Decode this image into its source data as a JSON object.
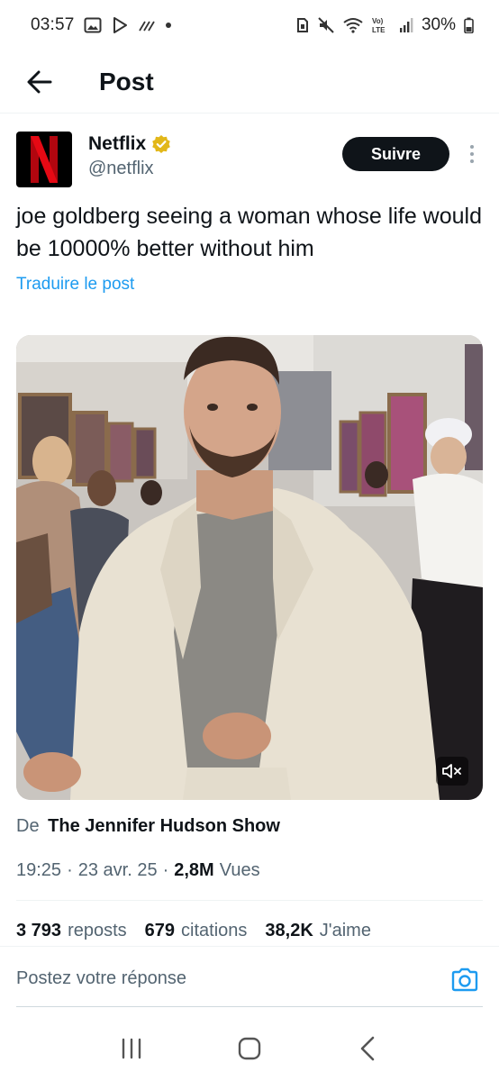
{
  "status_bar": {
    "time": "03:57",
    "network": "VoLTE LTE",
    "battery": "30%"
  },
  "header": {
    "title": "Post"
  },
  "author": {
    "display_name": "Netflix",
    "handle": "@netflix",
    "avatar_letter": "N",
    "verified": true,
    "follow_label": "Suivre"
  },
  "post": {
    "text": "joe goldberg seeing a woman whose life would be 10000% better without him",
    "translate_label": "Traduire le post"
  },
  "media": {
    "type": "video",
    "muted": true
  },
  "source": {
    "prefix": "De",
    "name": "The Jennifer Hudson Show"
  },
  "meta": {
    "time": "19:25",
    "date": "23 avr. 25",
    "views_count": "2,8M",
    "views_label": "Vues"
  },
  "stats": {
    "reposts_count": "3 793",
    "reposts_label": "reposts",
    "quotes_count": "679",
    "quotes_label": "citations",
    "likes_count": "38,2K",
    "likes_label": "J'aime"
  },
  "reply": {
    "placeholder": "Postez votre réponse"
  },
  "colors": {
    "accent": "#1d9bf0",
    "netflix_red": "#e50914",
    "text_primary": "#0f1419",
    "text_secondary": "#536471",
    "verified_gold": "#e2b719"
  }
}
